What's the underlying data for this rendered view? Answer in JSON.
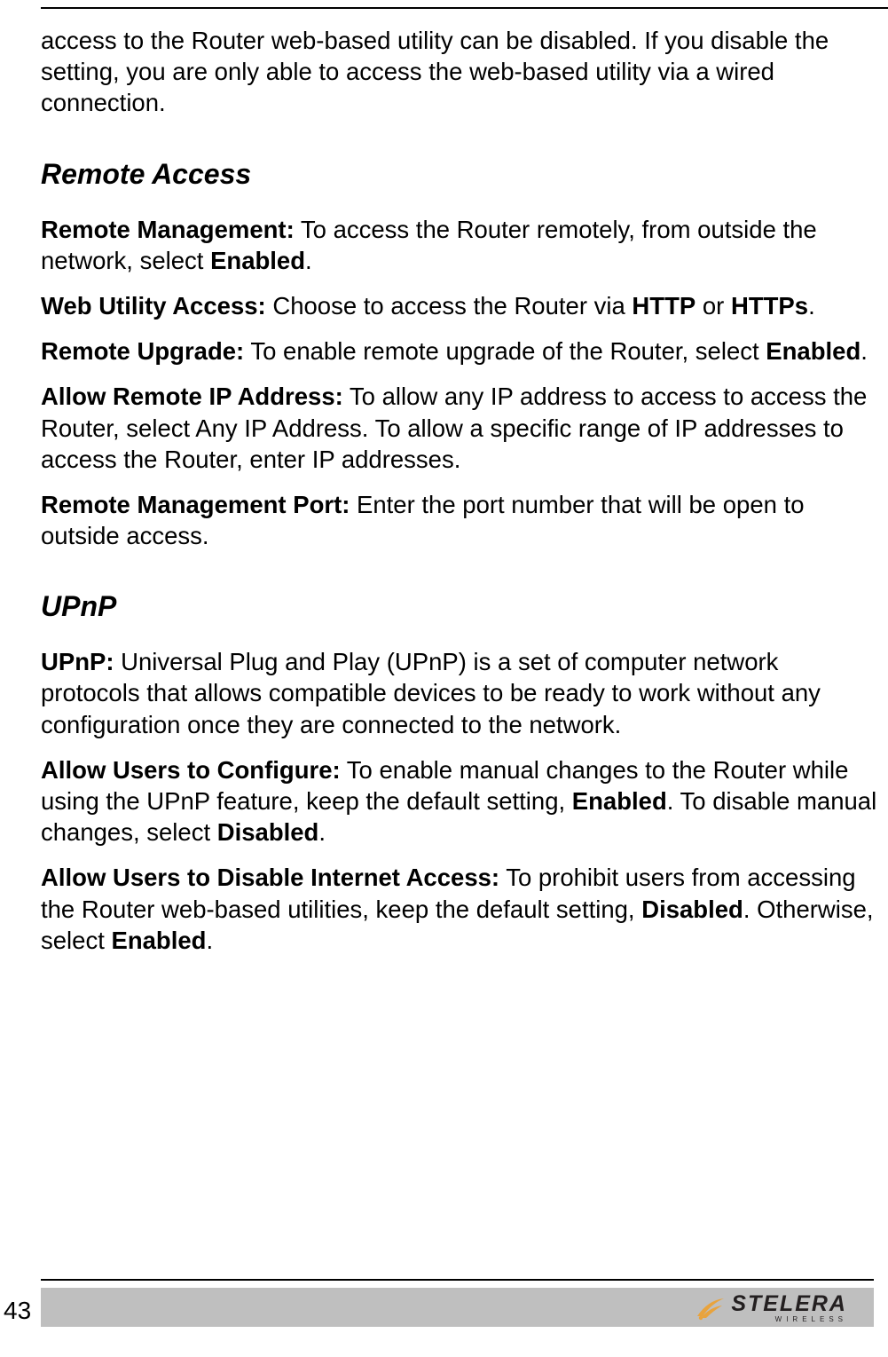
{
  "pageNumber": "43",
  "intro": {
    "text": "access to the Router web-based utility can be disabled. If you disable the setting, you are only able to access the web-based utility via a wired connection."
  },
  "sections": [
    {
      "heading": "Remote Access",
      "paragraphs": [
        {
          "label": "Remote Management:",
          "body": " To access the Router remotely, from outside the network, select ",
          "bold2": "Enabled",
          "tail": "."
        },
        {
          "label": "Web Utility Access:",
          "body": " Choose to access the Router via ",
          "bold2": "HTTP",
          "mid": " or ",
          "bold3": "HTTPs",
          "tail": "."
        },
        {
          "label": "Remote Upgrade:",
          "body": " To enable remote upgrade of the Router, select ",
          "bold2": "Enabled",
          "tail": "."
        },
        {
          "label": "Allow Remote IP Address:",
          "body": " To allow any IP address to access to access the Router, select Any IP Address. To allow a specific range of IP addresses to access the Router, enter IP addresses."
        },
        {
          "label": "Remote Management Port:",
          "body": " Enter the port number that will be open to outside access."
        }
      ]
    },
    {
      "heading": "UPnP",
      "paragraphs": [
        {
          "label": "UPnP:",
          "body": " Universal Plug and Play (UPnP) is a set of computer network protocols that allows compatible devices to be ready to work without any configuration once they are connected to the network."
        },
        {
          "label": "Allow Users to Configure:",
          "body": " To enable manual changes to the Router while using the UPnP feature, keep the default setting, ",
          "bold2": "Enabled",
          "mid": ". To disable manual changes, select ",
          "bold3": "Disabled",
          "tail": "."
        },
        {
          "label": "Allow Users to Disable Internet Access:",
          "body": " To prohibit users from accessing the Router web-based utilities, keep the default setting, ",
          "bold2": "Disabled",
          "mid": ". Otherwise, select ",
          "bold3": "Enabled",
          "tail": "."
        }
      ]
    }
  ],
  "logo": {
    "main": "STELERA",
    "sub": "WIRELESS"
  }
}
